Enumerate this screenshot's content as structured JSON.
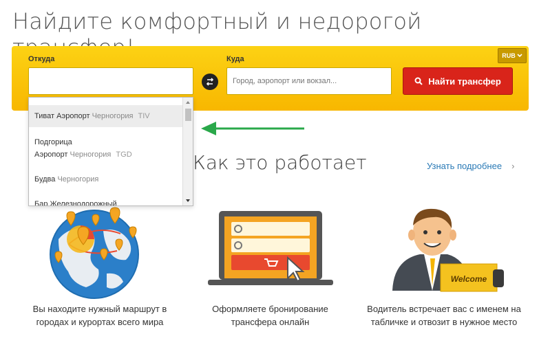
{
  "headline": "Найдите комфортный и недорогой трансфер!",
  "search": {
    "from_label": "Откуда",
    "from_value": "",
    "to_label": "Куда",
    "to_placeholder": "Город, аэропорт или вокзал...",
    "submit_label": "Найти трансфер",
    "currency": "RUB",
    "accent_color": "#fcd214",
    "button_color": "#d9241a"
  },
  "dropdown": {
    "items": [
      {
        "name": "Тиват Аэропорт",
        "country": "Черногория",
        "code": "TIV"
      },
      {
        "line1": "Подгорица",
        "name": "Аэропорт",
        "country": "Черногория",
        "code": "TGD"
      },
      {
        "name": "Будва",
        "country": "Черногория"
      },
      {
        "name": "Бар Железнодорожный"
      }
    ]
  },
  "how": {
    "title": "Как это работает",
    "learn_more": "Узнать подробнее",
    "chevron": "›"
  },
  "steps": [
    {
      "icon": "globe-icon",
      "caption": "Вы находите нужный маршрут в городах и курортах всего мира"
    },
    {
      "icon": "laptop-icon",
      "caption": "Оформляете бронирование трансфера онлайн"
    },
    {
      "icon": "driver-icon",
      "caption": "Водитель встречает вас с именем на табличке и отвозит в нужное место",
      "sign": "Welcome"
    }
  ]
}
